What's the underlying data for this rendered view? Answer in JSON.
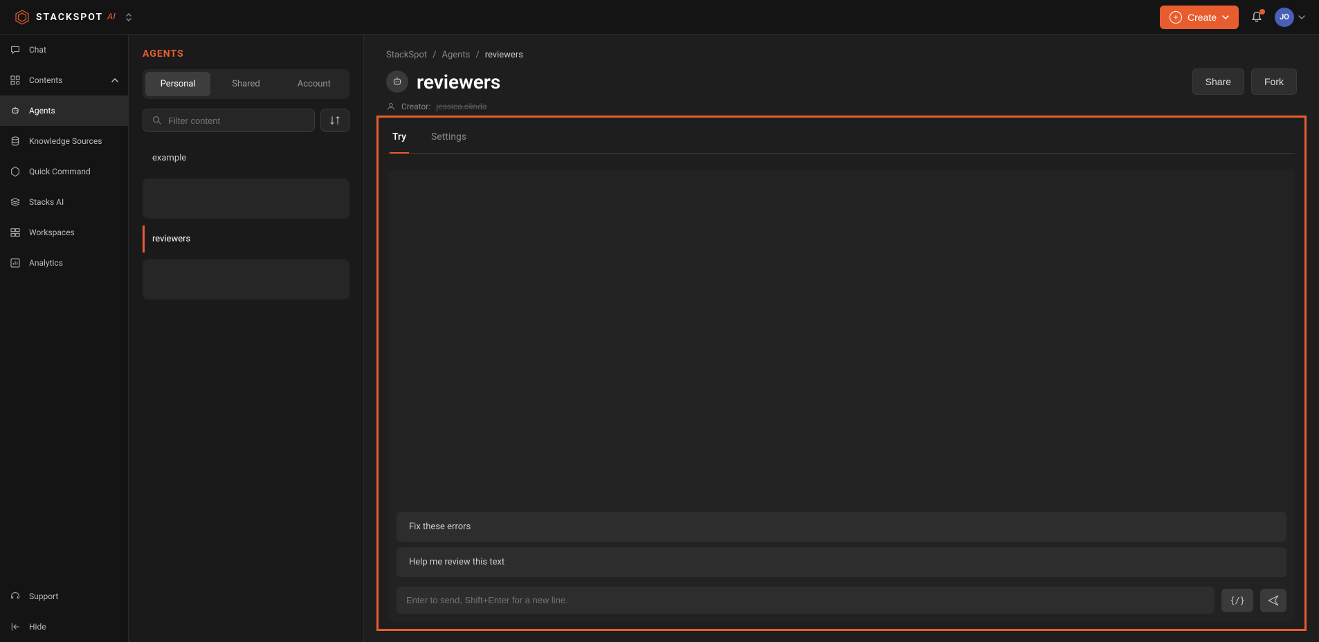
{
  "header": {
    "brand": "STACKSPOT",
    "brand_suffix": "AI",
    "create_label": "Create",
    "avatar_initials": "JO"
  },
  "primary_nav": {
    "chat": "Chat",
    "contents": "Contents",
    "agents": "Agents",
    "knowledge_sources": "Knowledge Sources",
    "quick_command": "Quick Command",
    "stacks_ai": "Stacks AI",
    "workspaces": "Workspaces",
    "analytics": "Analytics",
    "support": "Support",
    "hide": "Hide"
  },
  "secondary_panel": {
    "title": "AGENTS",
    "tabs": {
      "personal": "Personal",
      "shared": "Shared",
      "account": "Account"
    },
    "filter_placeholder": "Filter content",
    "items": {
      "example": "example",
      "reviewers": "reviewers"
    }
  },
  "breadcrumbs": {
    "root": "StackSpot",
    "section": "Agents",
    "current": "reviewers"
  },
  "page": {
    "title": "reviewers",
    "creator_label": "Creator:",
    "creator_name": "jessica.olinda",
    "share": "Share",
    "fork": "Fork"
  },
  "tabs": {
    "try": "Try",
    "settings": "Settings"
  },
  "chat": {
    "suggestions": {
      "fix_errors": "Fix these errors",
      "review_text": "Help me review this text"
    },
    "input_placeholder": "Enter to send, Shift+Enter for a new line.",
    "code_glyph": "{/}"
  }
}
